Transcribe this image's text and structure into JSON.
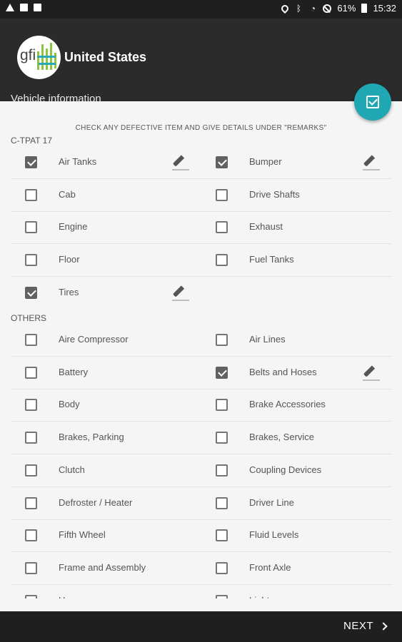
{
  "status_bar": {
    "battery": "61%",
    "time": "15:32"
  },
  "header": {
    "logo_text": "gfi",
    "country": "United States",
    "subtitle": "Vehicle information"
  },
  "fab": {
    "icon": "checkbox-icon",
    "color": "#1fa8b3"
  },
  "instruction": "CHECK ANY DEFECTIVE ITEM AND GIVE DETAILS UNDER \"REMARKS\"",
  "sections": [
    {
      "title": "C-TPAT 17",
      "rows": [
        [
          {
            "label": "Air Tanks",
            "checked": true
          },
          {
            "label": "Bumper",
            "checked": true
          }
        ],
        [
          {
            "label": "Cab",
            "checked": false
          },
          {
            "label": "Drive Shafts",
            "checked": false
          }
        ],
        [
          {
            "label": "Engine",
            "checked": false
          },
          {
            "label": "Exhaust",
            "checked": false
          }
        ],
        [
          {
            "label": "Floor",
            "checked": false
          },
          {
            "label": "Fuel Tanks",
            "checked": false
          }
        ],
        [
          {
            "label": "Tires",
            "checked": true
          },
          null
        ]
      ]
    },
    {
      "title": "OTHERS",
      "rows": [
        [
          {
            "label": "Aire Compressor",
            "checked": false
          },
          {
            "label": "Air Lines",
            "checked": false
          }
        ],
        [
          {
            "label": "Battery",
            "checked": false
          },
          {
            "label": "Belts and Hoses",
            "checked": true
          }
        ],
        [
          {
            "label": "Body",
            "checked": false
          },
          {
            "label": "Brake Accessories",
            "checked": false
          }
        ],
        [
          {
            "label": "Brakes, Parking",
            "checked": false
          },
          {
            "label": "Brakes, Service",
            "checked": false
          }
        ],
        [
          {
            "label": "Clutch",
            "checked": false
          },
          {
            "label": "Coupling Devices",
            "checked": false
          }
        ],
        [
          {
            "label": "Defroster / Heater",
            "checked": false
          },
          {
            "label": "Driver Line",
            "checked": false
          }
        ],
        [
          {
            "label": "Fifth Wheel",
            "checked": false
          },
          {
            "label": "Fluid Levels",
            "checked": false
          }
        ],
        [
          {
            "label": "Frame and Assembly",
            "checked": false
          },
          {
            "label": "Front Axle",
            "checked": false
          }
        ],
        [
          {
            "label": "Horn",
            "checked": false
          },
          {
            "label": "Lights",
            "checked": false
          }
        ]
      ]
    }
  ],
  "footer": {
    "next_label": "NEXT"
  }
}
